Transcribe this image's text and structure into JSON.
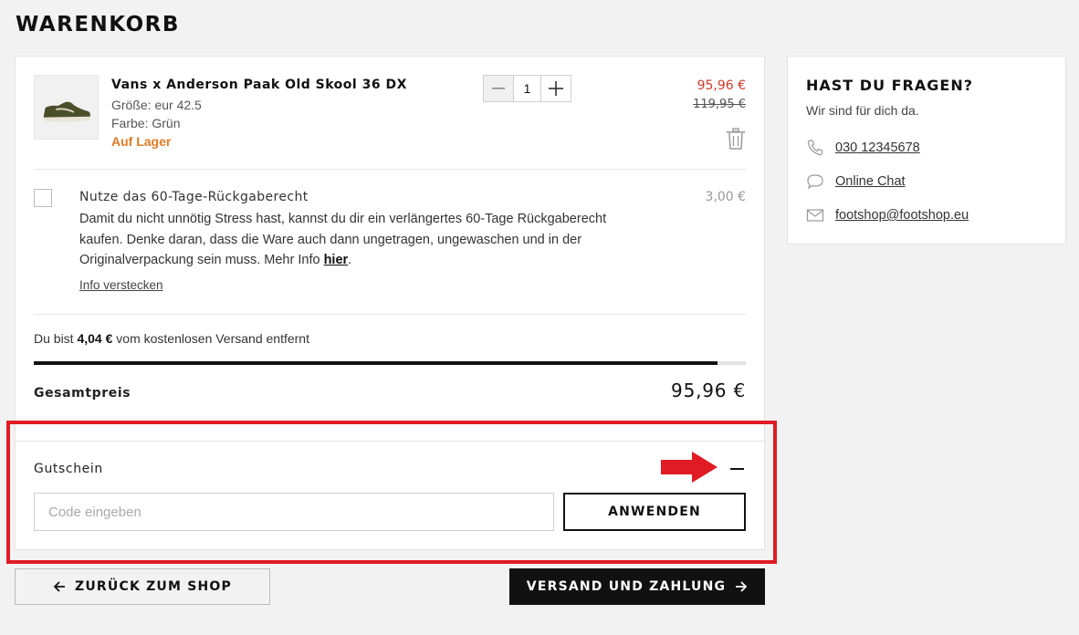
{
  "page": {
    "title": "WARENKORB"
  },
  "product": {
    "name": "Vans x Anderson Paak Old Skool 36 DX",
    "size": "Größe: eur 42.5",
    "color": "Farbe: Grün",
    "stock": "Auf Lager",
    "quantity": "1",
    "price_new": "95,96 €",
    "price_old": "119,95 €",
    "image_icon": "shoe-thumbnail"
  },
  "return_option": {
    "title": "Nutze das 60-Tage-Rückgaberecht",
    "price": "3,00 €",
    "text": "Damit du nicht unnötig Stress hast, kannst du dir ein verlängertes 60-Tage Rückgaberecht kaufen. Denke daran, dass die Ware auch dann ungetragen, ungewaschen und in der Originalverpackung sein muss. Mehr Info",
    "link": "hier",
    "hide_link": "Info verstecken"
  },
  "shipping": {
    "prefix": "Du bist",
    "amount": "4,04 €",
    "suffix": "vom kostenlosen Versand entfernt",
    "progress_percent": 96
  },
  "total": {
    "label": "Gesamtpreis",
    "value": "95,96 €"
  },
  "voucher": {
    "label": "Gutschein",
    "placeholder": "Code eingeben",
    "apply_label": "ANWENDEN"
  },
  "nav": {
    "back_label": "ZURÜCK ZUM SHOP",
    "next_label": "VERSAND UND ZAHLUNG"
  },
  "help": {
    "title": "HAST DU FRAGEN?",
    "subtitle": "Wir sind für dich da.",
    "phone": "030 12345678",
    "chat": "Online Chat",
    "email": "footshop@footshop.eu"
  },
  "colors": {
    "accent_red": "#e01b24",
    "price_red": "#d0392b",
    "stock_orange": "#e07a24"
  }
}
